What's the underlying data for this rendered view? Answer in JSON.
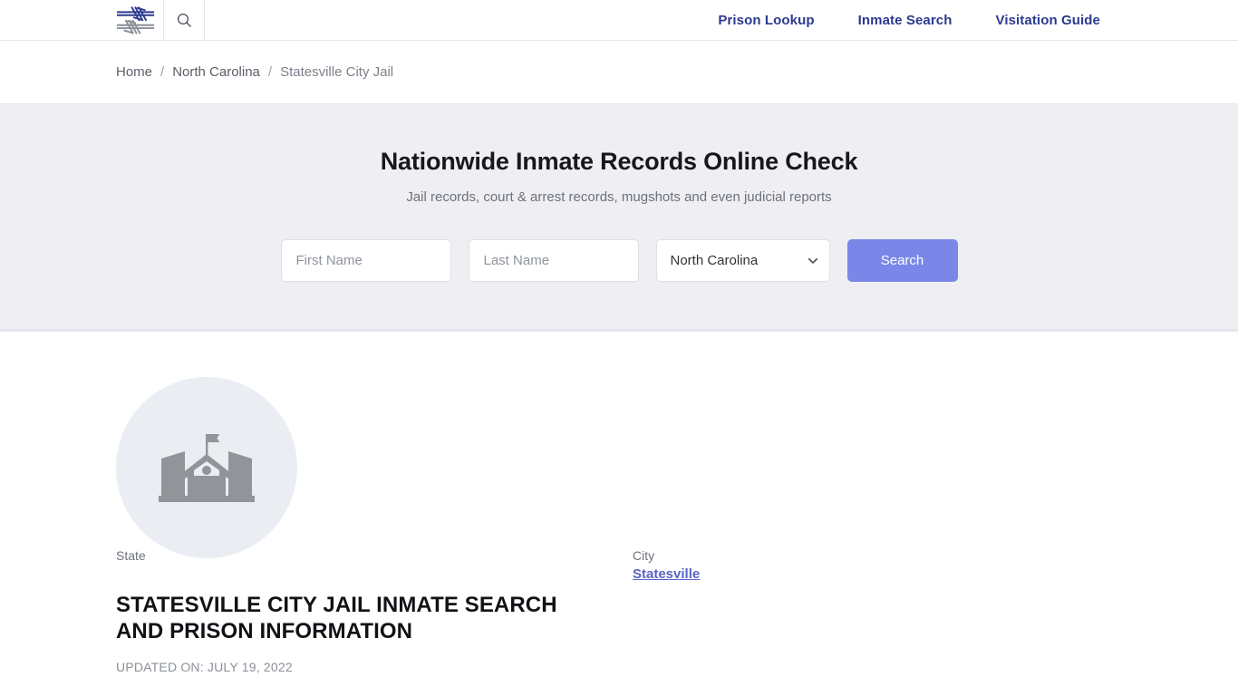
{
  "header": {
    "logo_name": "barbed-wire-logo",
    "logo_colors": {
      "top_strand": "#2b3a8f",
      "bottom_strand": "#8a8f98"
    },
    "search_icon": "search-icon",
    "nav": [
      {
        "label": "Prison Lookup"
      },
      {
        "label": "Inmate Search"
      },
      {
        "label": "Visitation Guide"
      }
    ],
    "nav_color": "#2b3a8f"
  },
  "breadcrumb": {
    "items": [
      {
        "label": "Home"
      },
      {
        "label": "North Carolina"
      },
      {
        "label": "Statesville City Jail"
      }
    ],
    "separator": "/"
  },
  "hero": {
    "title": "Nationwide Inmate Records Online Check",
    "subtitle": "Jail records, court & arrest records, mugshots and even judicial reports",
    "background": "#eeeef3",
    "form": {
      "first_name_placeholder": "First Name",
      "first_name_value": "",
      "last_name_placeholder": "Last Name",
      "last_name_value": "",
      "state_selected": "North Carolina",
      "state_options": [
        "North Carolina"
      ],
      "search_label": "Search",
      "search_button_color": "#7b87e8"
    }
  },
  "main": {
    "avatar_icon": "government-building-icon",
    "avatar_background": "#eaeef2",
    "avatar_icon_color": "#919499",
    "page_title": "STATESVILLE CITY JAIL INMATE SEARCH AND PRISON INFORMATION",
    "updated_on": "UPDATED ON: JULY 19, 2022",
    "info": {
      "state_label": "State",
      "city_label": "City",
      "city_value": "Statesville"
    }
  }
}
